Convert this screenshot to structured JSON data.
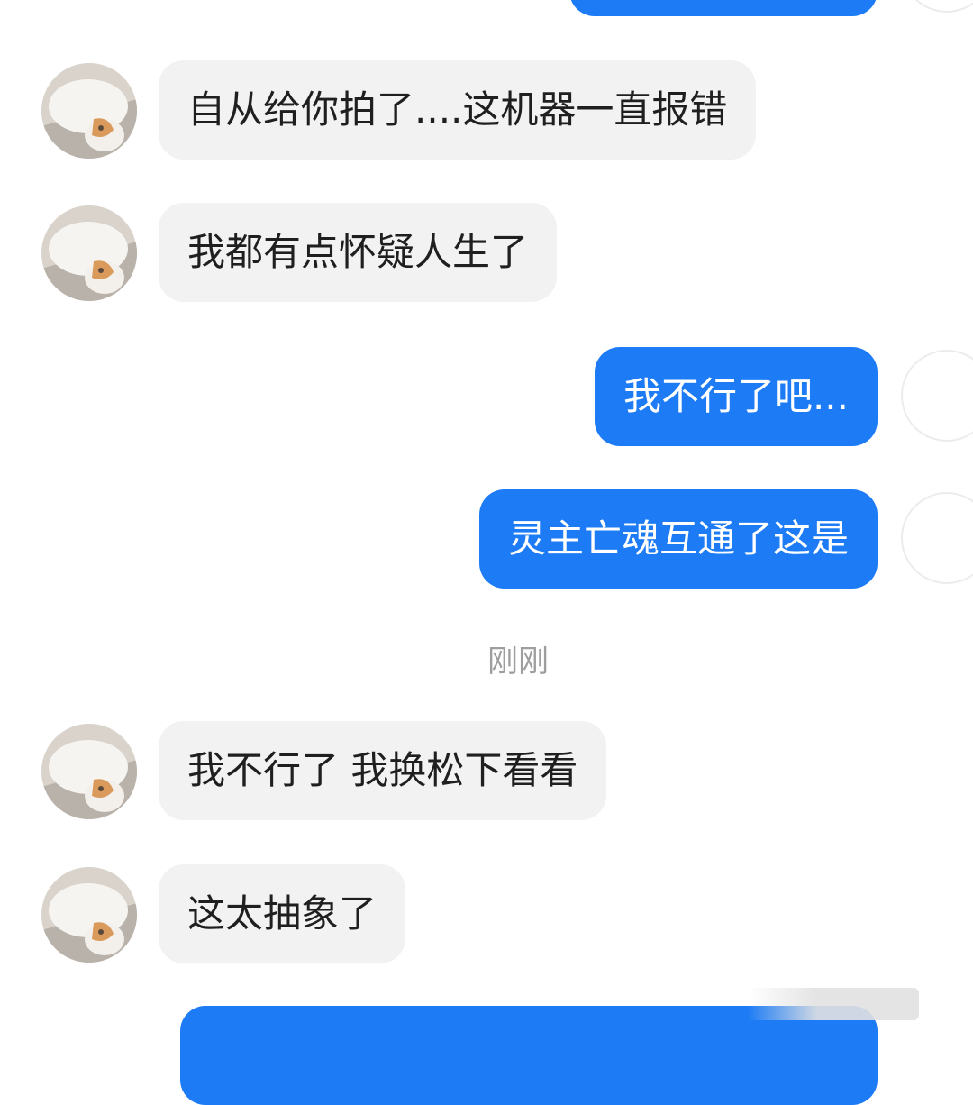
{
  "conversation": {
    "timestamp": "刚刚",
    "messages": [
      {
        "side": "incoming",
        "text": "自从给你拍了....这机器一直报错"
      },
      {
        "side": "incoming",
        "text": "我都有点怀疑人生了"
      },
      {
        "side": "outgoing",
        "text": "我不行了吧..."
      },
      {
        "side": "outgoing",
        "text": "灵主亡魂互通了这是"
      },
      {
        "side": "incoming",
        "text": "我不行了 我换松下看看"
      },
      {
        "side": "incoming",
        "text": "这太抽象了"
      }
    ]
  },
  "colors": {
    "outgoing_bubble": "#1d7cf5",
    "incoming_bubble": "#f2f2f2",
    "timestamp_text": "#9e9e9e"
  },
  "icons": {
    "contact_avatar": "cat-photo-avatar",
    "self_avatar": "blank-avatar"
  }
}
